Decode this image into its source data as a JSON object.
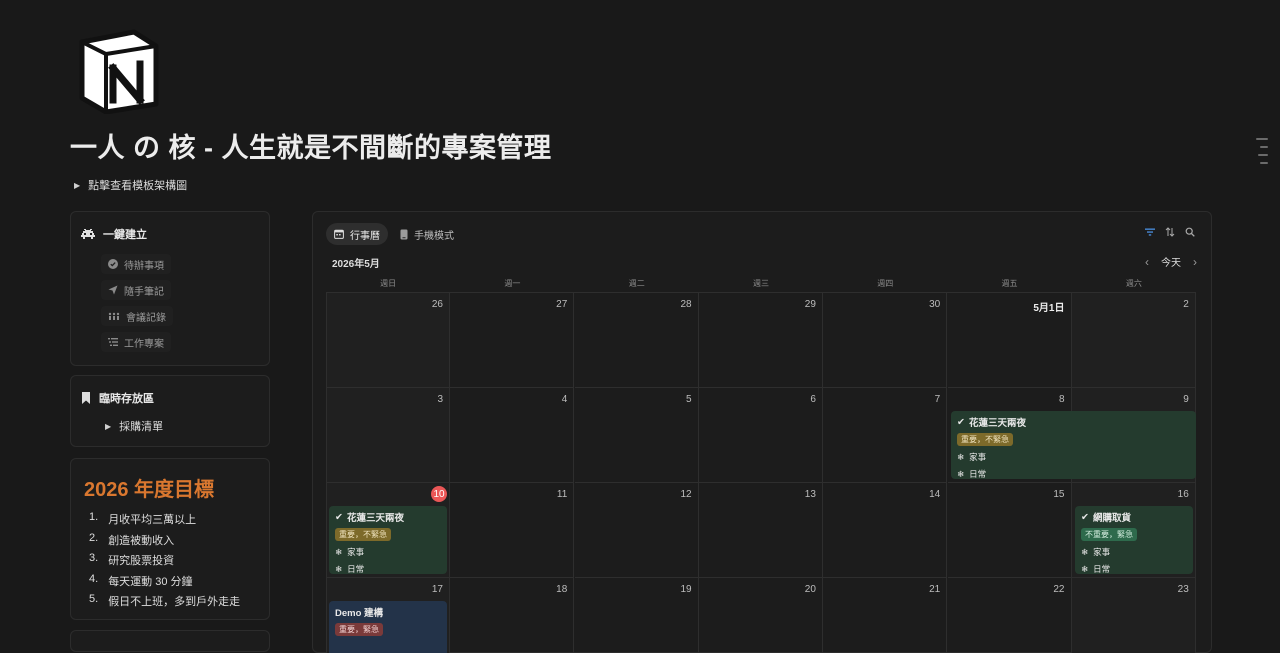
{
  "page": {
    "title": "一人 の 核 - 人生就是不間斷的專案管理",
    "template_toggle": "點擊查看模板架構圖"
  },
  "quick_create": {
    "title": "一鍵建立",
    "buttons": [
      "待辦事項",
      "隨手筆記",
      "會議記錄",
      "工作專案"
    ]
  },
  "temp_storage": {
    "title": "臨時存放區",
    "toggle": "採購清單"
  },
  "goals": {
    "title": "2026 年度目標",
    "items": [
      {
        "num": "1.",
        "text": "月收平均三萬以上"
      },
      {
        "num": "2.",
        "text": "創造被動收入"
      },
      {
        "num": "3.",
        "text": "研究股票投資"
      },
      {
        "num": "4.",
        "text": "每天運動 30 分鐘"
      },
      {
        "num": "5.",
        "text": "假日不上班，多到戶外走走"
      }
    ]
  },
  "calendar": {
    "tabs": [
      "行事曆",
      "手機模式"
    ],
    "month": "2026年5月",
    "today_button": "今天",
    "weekdays": [
      "週日",
      "週一",
      "週二",
      "週三",
      "週四",
      "週五",
      "週六"
    ],
    "weeks": [
      [
        "26",
        "27",
        "28",
        "29",
        "30",
        "5月1日",
        "2"
      ],
      [
        "3",
        "4",
        "5",
        "6",
        "7",
        "8",
        "9"
      ],
      [
        "10",
        "11",
        "12",
        "13",
        "14",
        "15",
        "16"
      ],
      [
        "17",
        "18",
        "19",
        "20",
        "21",
        "22",
        "23"
      ]
    ],
    "today": "10",
    "events": {
      "e1": {
        "title": "花蓮三天兩夜",
        "tag": "重要，不緊急",
        "line1": "家事",
        "line2": "日常"
      },
      "e2": {
        "title": "花蓮三天兩夜",
        "tag": "重要，不緊急",
        "line1": "家事",
        "line2": "日常"
      },
      "e3": {
        "title": "網購取貨",
        "tag": "不重要，緊急",
        "line1": "家事",
        "line2": "日常"
      },
      "e4": {
        "title": "Demo 建構",
        "tag": "重要，緊急"
      }
    },
    "colors": {
      "green_event": "#243b2e",
      "blue_event": "#233349",
      "today": "#eb5757",
      "accent_filter": "#4a90e2"
    }
  }
}
